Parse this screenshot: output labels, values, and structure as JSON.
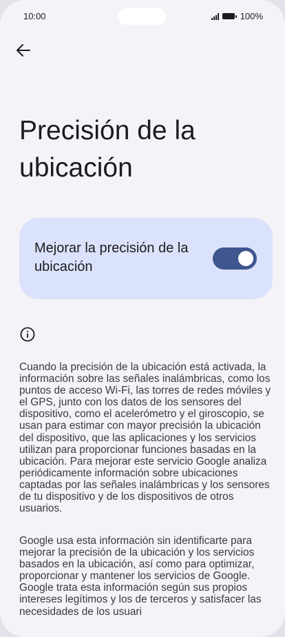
{
  "status_bar": {
    "time": "10:00",
    "battery": "100%"
  },
  "header": {
    "back_icon": "arrow-back-icon"
  },
  "title": "Precisión de la ubicación",
  "toggle_card": {
    "label": "Mejorar la precisión de la ubicación",
    "enabled": true,
    "accent": "#3f568f",
    "background": "#dbe2fb"
  },
  "info": {
    "icon": "info-icon",
    "paragraph1": "Cuando la precisión de la ubicación está activada, la información sobre las señales inalámbricas, como los puntos de acceso Wi-Fi, las torres de redes móviles y el GPS, junto con los datos de los sensores del dispositivo, como el acelerómetro y el giroscopio, se usan para estimar con mayor precisión la ubicación del dispositivo, que las aplicaciones y los servicios utilizan para proporcionar funciones basadas en la ubicación. Para mejorar este servicio Google analiza periódicamente información sobre ubicaciones captadas por las señales inalámbricas y los sensores de tu dispositivo y de los dispositivos de otros usuarios.",
    "paragraph2": "Google usa esta información sin identificarte para mejorar la precisión de la ubicación y los servicios basados en la ubicación, así como para optimizar, proporcionar y mantener los servicios de Google. Google trata esta información según sus propios intereses legítimos y los de terceros y satisfacer las necesidades de los usuari"
  }
}
